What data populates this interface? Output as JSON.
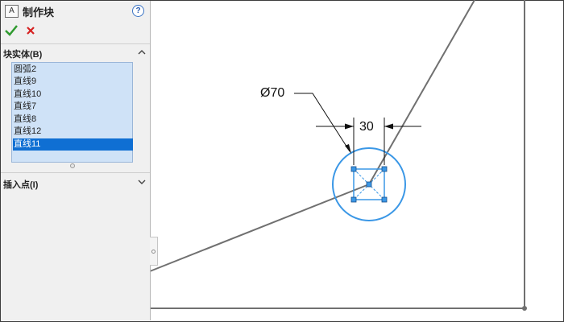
{
  "property_manager": {
    "title": "制作块",
    "help_glyph": "?",
    "ok_label": "✔",
    "cancel_label": "✕",
    "block_entities": {
      "title": "块实体(B)",
      "items": [
        {
          "label": "圆弧2",
          "selected": false
        },
        {
          "label": "直线9",
          "selected": false
        },
        {
          "label": "直线10",
          "selected": false
        },
        {
          "label": "直线7",
          "selected": false
        },
        {
          "label": "直线8",
          "selected": false
        },
        {
          "label": "直线12",
          "selected": false
        },
        {
          "label": "直线11",
          "selected": true
        }
      ]
    },
    "insertion_point": {
      "title": "插入点(I)"
    }
  },
  "graphics": {
    "diameter_dimension": "Ø70",
    "linear_dimension": "30",
    "colors": {
      "sketch_line": "#707070",
      "selected_geometry": "#3a97e6",
      "dimension": "#111111"
    }
  }
}
